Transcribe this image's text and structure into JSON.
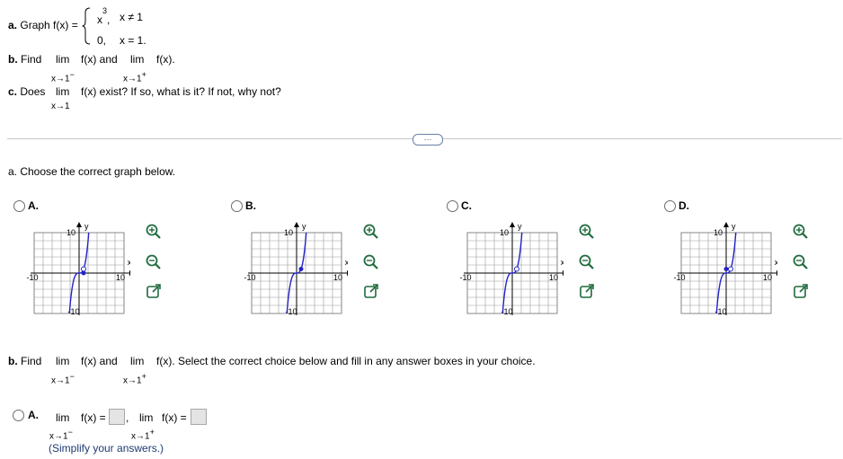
{
  "part_a_question": {
    "label": "a.",
    "text": "Graph f(x) =",
    "piece1_expr": "x",
    "piece1_exp": "3",
    "piece1_sep": ",",
    "piece1_cond": "x ≠ 1",
    "piece2_expr": "0,",
    "piece2_cond": "x = 1."
  },
  "part_b_question": {
    "label": "b.",
    "find": "Find",
    "lim1": "lim",
    "f1": "f(x) and",
    "lim2": "lim",
    "f2": "f(x).",
    "sub1": "x→1",
    "sub1_sign": "−",
    "sub2": "x→1",
    "sub2_sign": "+"
  },
  "part_c_question": {
    "label": "c.",
    "does": "Does",
    "lim": "lim",
    "rest": "f(x) exist? If so, what is it? If not, why not?",
    "sub": "x→1"
  },
  "more_button": "···",
  "part_a_prompt": "a. Choose the correct graph below.",
  "options": [
    {
      "letter": "A.",
      "y_label": "y",
      "x_label": "x",
      "y_top": "10",
      "y_bottom": "-10",
      "x_left": "-10",
      "x_right": "10"
    },
    {
      "letter": "B.",
      "y_label": "y",
      "x_label": "x",
      "y_top": "10",
      "y_bottom": "-10",
      "x_left": "-10",
      "x_right": "10"
    },
    {
      "letter": "C.",
      "y_label": "y",
      "x_label": "x",
      "y_top": "10",
      "y_bottom": "-10",
      "x_left": "-10",
      "x_right": "10"
    },
    {
      "letter": "D.",
      "y_label": "y",
      "x_label": "x",
      "y_top": "10",
      "y_bottom": "-10",
      "x_left": "-10",
      "x_right": "10"
    }
  ],
  "part_b_prompt": {
    "label": "b.",
    "find": "Find",
    "lim1": "lim",
    "f1": "f(x) and",
    "lim2": "lim",
    "rest": "f(x). Select the correct choice below and fill in any answer boxes in your choice.",
    "sub1": "x→1",
    "sub1_sign": "−",
    "sub2": "x→1",
    "sub2_sign": "+"
  },
  "answer_a": {
    "letter": "A.",
    "lim1": "lim",
    "f1": "f(x) =",
    "comma": ",",
    "lim2": "lim",
    "f2": "f(x) =",
    "sub1": "x→1",
    "sub1_sign": "−",
    "sub2": "x→1",
    "sub2_sign": "+",
    "hint": "(Simplify your answers.)"
  },
  "colors": {
    "curve": "#2323c8",
    "grid": "#9a9a9a",
    "accent": "#1f3a74"
  },
  "icons": [
    "zoom-in-icon",
    "zoom-out-icon",
    "pop-out-icon",
    "brace-icon"
  ]
}
